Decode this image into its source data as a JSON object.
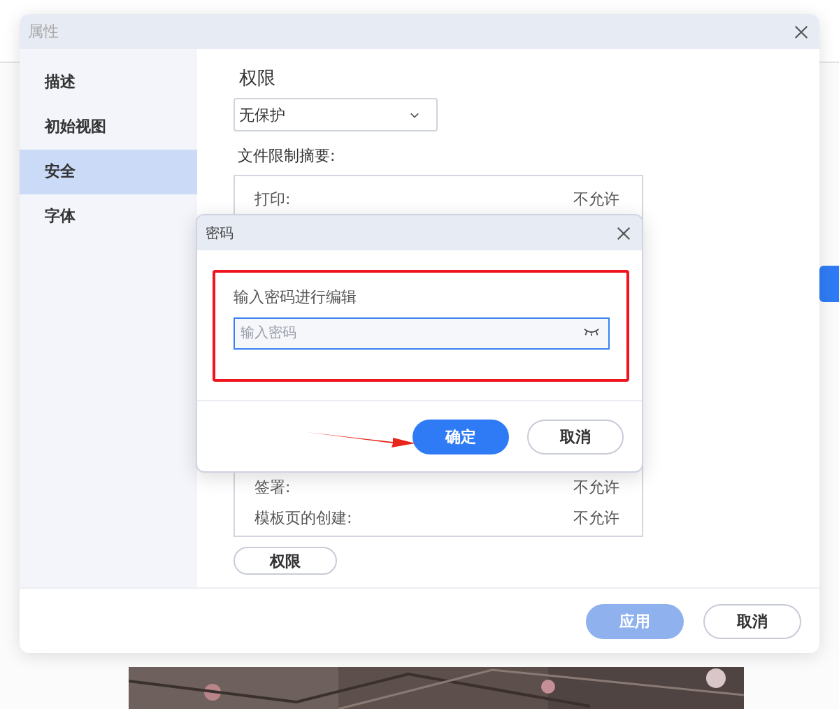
{
  "properties_dialog": {
    "title": "属性",
    "sidebar": [
      {
        "label": "描述",
        "selected": false
      },
      {
        "label": "初始视图",
        "selected": false
      },
      {
        "label": "安全",
        "selected": true
      },
      {
        "label": "字体",
        "selected": false
      }
    ],
    "permission_label": "权限",
    "permission_select": {
      "value": "无保护"
    },
    "summary_label": "文件限制摘要:",
    "summary_top": [
      {
        "name": "打印:",
        "value": "不允许"
      }
    ],
    "summary_bottom": [
      {
        "name": "签署:",
        "value": "不允许"
      },
      {
        "name": "模板页的创建:",
        "value": "不允许"
      }
    ],
    "permission_button": "权限",
    "buttons": [
      {
        "label": "应用",
        "disabled": true
      },
      {
        "label": "取消",
        "disabled": false
      }
    ]
  },
  "password_dialog": {
    "title": "密码",
    "prompt": "输入密码进行编辑",
    "password_field": {
      "placeholder": "输入密码"
    },
    "buttons": [
      {
        "label": "确定",
        "primary": true
      },
      {
        "label": "取消",
        "primary": false
      }
    ]
  },
  "annotations": {
    "highlight_box": true,
    "arrow": true
  }
}
